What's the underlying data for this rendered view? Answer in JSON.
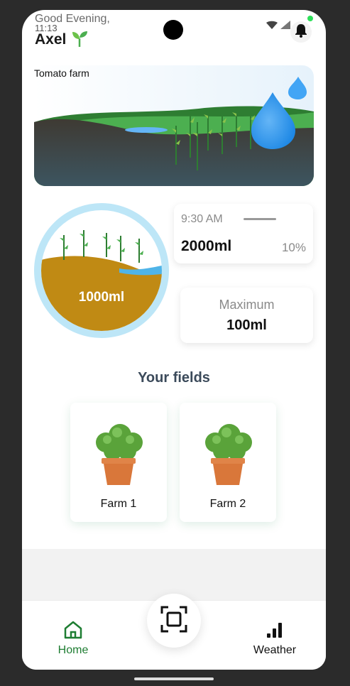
{
  "status": {
    "time": "11:13"
  },
  "header": {
    "greeting": "Good Evening,",
    "username": "Axel"
  },
  "farm": {
    "title": "Tomato farm"
  },
  "gauge": {
    "value": "1000ml",
    "fill_level": 0.6
  },
  "schedule_card": {
    "time": "9:30 AM",
    "amount": "2000ml",
    "percent": "10%"
  },
  "max_card": {
    "label": "Maximum",
    "value": "100ml"
  },
  "fields": {
    "title": "Your fields",
    "items": [
      {
        "name": "Farm 1"
      },
      {
        "name": "Farm 2"
      }
    ]
  },
  "nav": {
    "home_label": "Home",
    "weather_label": "Weather"
  },
  "colors": {
    "accent": "#1e7d32",
    "soil": "#c08a14",
    "water": "#42a5f5",
    "ring": "#bde6f7"
  },
  "icons": [
    "sprout-icon",
    "wifi-icon",
    "signal-icon",
    "bell-icon",
    "water-drop-icon",
    "home-icon",
    "scan-icon",
    "signal-bars-icon"
  ]
}
